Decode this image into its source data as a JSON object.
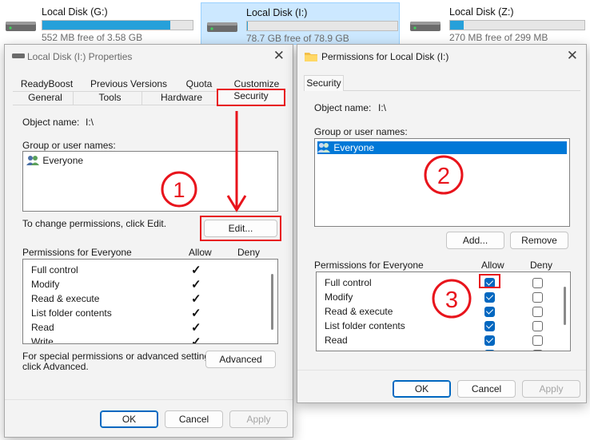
{
  "drives": [
    {
      "name": "Local Disk (G:)",
      "free": "552 MB free of 3.58 GB",
      "used_fraction": 0.85,
      "selected": false
    },
    {
      "name": "Local Disk (I:)",
      "free": "78.7 GB free of 78.9 GB",
      "used_fraction": 0.005,
      "selected": true
    },
    {
      "name": "Local Disk (Z:)",
      "free": "270 MB free of 299 MB",
      "used_fraction": 0.1,
      "selected": false
    }
  ],
  "properties": {
    "title": "Local Disk (I:) Properties",
    "tabs_row1": [
      "ReadyBoost",
      "Previous Versions",
      "Quota",
      "Customize"
    ],
    "tabs_row2": [
      "General",
      "Tools",
      "Hardware",
      "Security"
    ],
    "object_name_label": "Object name:",
    "object_name_value": "I:\\",
    "group_label": "Group or user names:",
    "users": [
      "Everyone"
    ],
    "change_hint": "To change permissions, click Edit.",
    "edit_button": "Edit...",
    "perm_header": "Permissions for Everyone",
    "allow_header": "Allow",
    "deny_header": "Deny",
    "permissions": [
      {
        "name": "Full control",
        "allow": true,
        "deny": false
      },
      {
        "name": "Modify",
        "allow": true,
        "deny": false
      },
      {
        "name": "Read & execute",
        "allow": true,
        "deny": false
      },
      {
        "name": "List folder contents",
        "allow": true,
        "deny": false
      },
      {
        "name": "Read",
        "allow": true,
        "deny": false
      },
      {
        "name": "Write",
        "allow": true,
        "deny": false
      }
    ],
    "special_text_1": "For special permissions or advanced settings,",
    "special_text_2": "click Advanced.",
    "advanced_button": "Advanced",
    "ok": "OK",
    "cancel": "Cancel",
    "apply": "Apply"
  },
  "permissions_dialog": {
    "title": "Permissions for Local Disk (I:)",
    "tab": "Security",
    "object_name_label": "Object name:",
    "object_name_value": "I:\\",
    "group_label": "Group or user names:",
    "users": [
      "Everyone"
    ],
    "add_button": "Add...",
    "remove_button": "Remove",
    "perm_header": "Permissions for Everyone",
    "allow_header": "Allow",
    "deny_header": "Deny",
    "permissions": [
      {
        "name": "Full control",
        "allow": true,
        "deny": false
      },
      {
        "name": "Modify",
        "allow": true,
        "deny": false
      },
      {
        "name": "Read & execute",
        "allow": true,
        "deny": false
      },
      {
        "name": "List folder contents",
        "allow": true,
        "deny": false
      },
      {
        "name": "Read",
        "allow": true,
        "deny": false
      }
    ],
    "ok": "OK",
    "cancel": "Cancel",
    "apply": "Apply"
  },
  "annotations": {
    "step1": "①",
    "step2": "②",
    "step3": "③",
    "highlight_color": "#e8141c"
  },
  "icons": {
    "drive": "drive-icon",
    "users": "users-icon",
    "folder": "folder-icon",
    "close": "close-icon"
  }
}
